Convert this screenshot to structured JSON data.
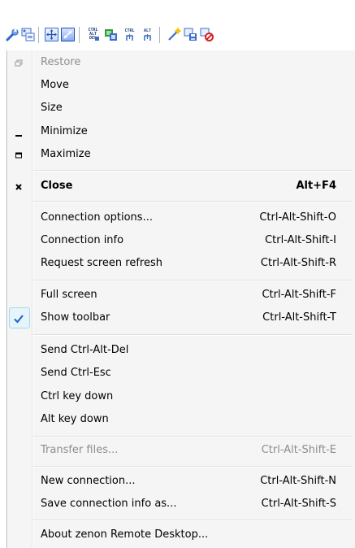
{
  "toolbar": {
    "buttons": [
      {
        "icon": "wrench-icon"
      },
      {
        "icon": "connection-info-icon"
      },
      {
        "icon": "full-screen-icon"
      },
      {
        "icon": "scale-icon"
      },
      {
        "icon": "ctrl-alt-del-icon",
        "text": "CTRL ALT DEL"
      },
      {
        "icon": "refresh-screen-icon"
      },
      {
        "icon": "ctrl-key-icon",
        "text": "CTRL"
      },
      {
        "icon": "alt-key-icon",
        "text": "ALT"
      },
      {
        "icon": "new-connection-icon"
      },
      {
        "icon": "save-connection-icon"
      },
      {
        "icon": "disconnect-icon"
      }
    ]
  },
  "menu": {
    "restore": {
      "label": "Restore"
    },
    "move": {
      "label": "Move"
    },
    "size": {
      "label": "Size"
    },
    "minimize": {
      "label": "Minimize"
    },
    "maximize": {
      "label": "Maximize"
    },
    "close": {
      "label": "Close",
      "shortcut": "Alt+F4"
    },
    "connection_options": {
      "label": "Connection options...",
      "shortcut": "Ctrl-Alt-Shift-O"
    },
    "connection_info": {
      "label": "Connection info",
      "shortcut": "Ctrl-Alt-Shift-I"
    },
    "request_refresh": {
      "label": "Request screen refresh",
      "shortcut": "Ctrl-Alt-Shift-R"
    },
    "full_screen": {
      "label": "Full screen",
      "shortcut": "Ctrl-Alt-Shift-F"
    },
    "show_toolbar": {
      "label": "Show toolbar",
      "shortcut": "Ctrl-Alt-Shift-T",
      "checked": true
    },
    "send_ctrl_alt_del": {
      "label": "Send Ctrl-Alt-Del"
    },
    "send_ctrl_esc": {
      "label": "Send Ctrl-Esc"
    },
    "ctrl_key_down": {
      "label": "Ctrl key down"
    },
    "alt_key_down": {
      "label": "Alt key down"
    },
    "transfer_files": {
      "label": "Transfer files...",
      "shortcut": "Ctrl-Alt-Shift-E",
      "disabled": true
    },
    "new_connection": {
      "label": "New connection...",
      "shortcut": "Ctrl-Alt-Shift-N"
    },
    "save_connection_info": {
      "label": "Save connection info as...",
      "shortcut": "Ctrl-Alt-Shift-S"
    },
    "about": {
      "label": "About zenon Remote Desktop..."
    }
  },
  "colors": {
    "menu_bg": "#f5f5f5",
    "disabled_text": "#8d8d8d",
    "check_blue": "#1c5fc8",
    "toolbar_blue": "#3a6cc8"
  }
}
